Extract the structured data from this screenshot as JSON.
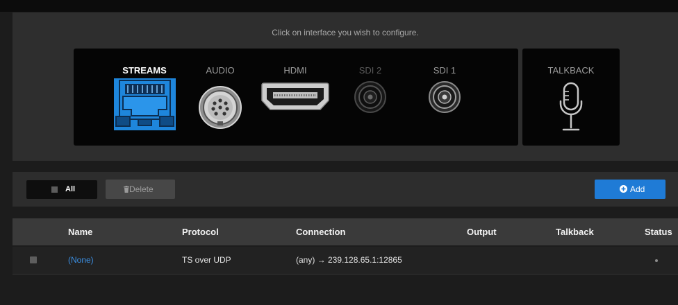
{
  "interface_panel": {
    "instruction": "Click on interface you wish to configure.",
    "interfaces": [
      {
        "label": "STREAMS",
        "icon": "ethernet-port-icon",
        "selected": true
      },
      {
        "label": "AUDIO",
        "icon": "audio-connector-icon",
        "selected": false
      },
      {
        "label": "HDMI",
        "icon": "hdmi-connector-icon",
        "selected": false
      },
      {
        "label": "SDI 2",
        "icon": "bnc-connector-icon",
        "selected": false,
        "dimmed": true
      },
      {
        "label": "SDI 1",
        "icon": "bnc-connector-icon",
        "selected": false
      }
    ],
    "talkback": {
      "label": "TALKBACK",
      "icon": "microphone-icon"
    }
  },
  "toolbar": {
    "select_all": {
      "label": "All",
      "checked": false
    },
    "delete": {
      "label": "Delete",
      "icon": "trash-icon",
      "enabled": false
    },
    "add": {
      "label": "Add",
      "icon": "plus-circle-icon"
    }
  },
  "table": {
    "columns": [
      "Name",
      "Protocol",
      "Connection",
      "Output",
      "Talkback",
      "Status"
    ],
    "rows": [
      {
        "checked": false,
        "name": "(None)",
        "protocol": "TS over UDP",
        "connection": "(any) → 239.128.65.1:12865",
        "status_icon": "status-dot-icon"
      }
    ]
  },
  "colors": {
    "accent": "#1f7bd6",
    "selected_interface": "#1e86dc",
    "link": "#3b8fe3"
  }
}
